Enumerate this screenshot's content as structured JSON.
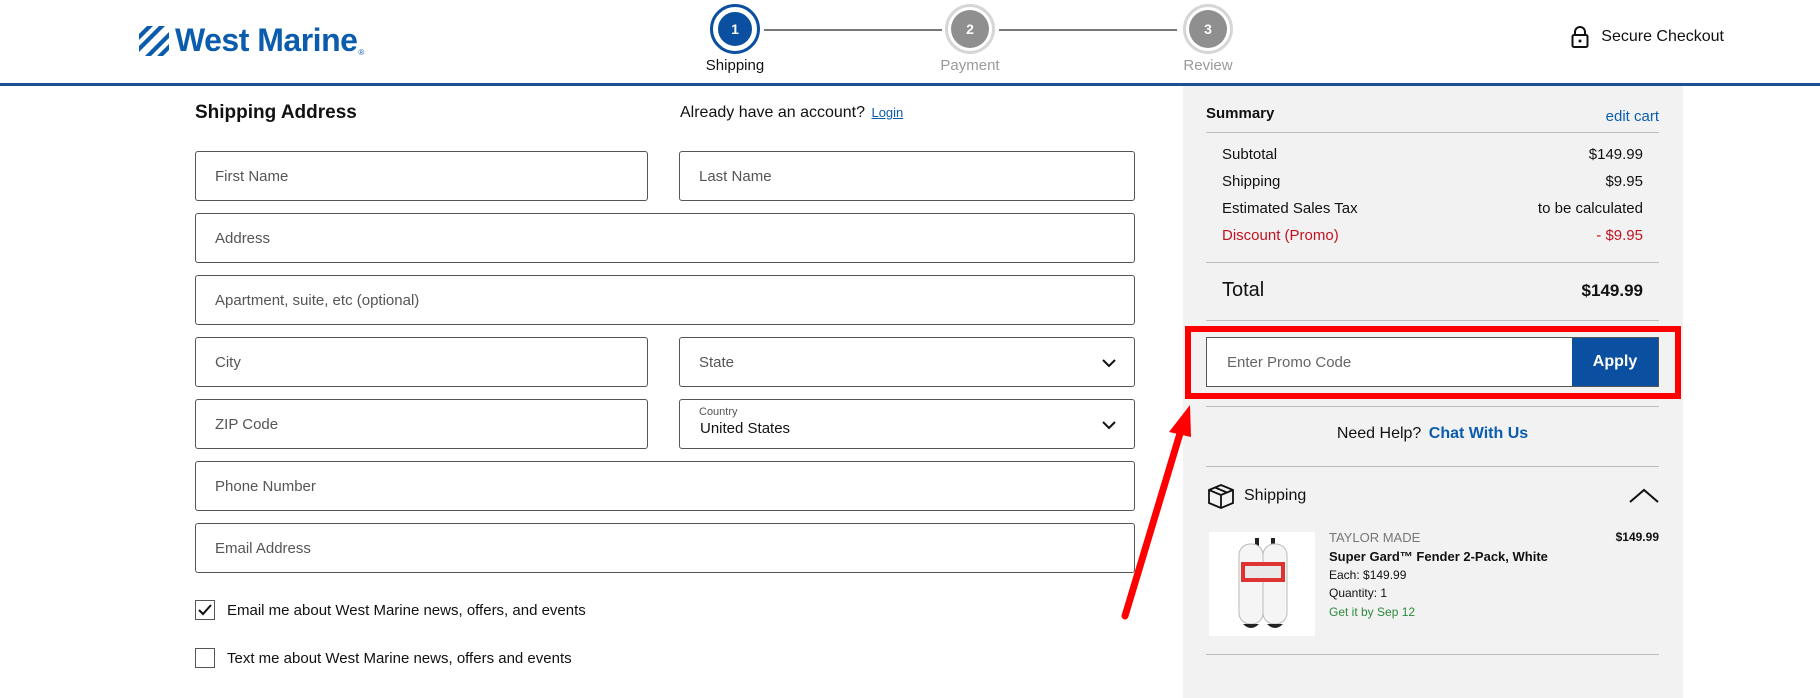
{
  "brand": {
    "name": "West Marine",
    "tm": "®",
    "color": "#0b5cad"
  },
  "steps": [
    {
      "number": "1",
      "label": "Shipping",
      "state": "active"
    },
    {
      "number": "2",
      "label": "Payment",
      "state": "inactive"
    },
    {
      "number": "3",
      "label": "Review",
      "state": "inactive"
    }
  ],
  "header": {
    "secure_label": "Secure Checkout"
  },
  "form": {
    "title": "Shipping Address",
    "account_prompt": "Already have an account?",
    "login_label": "Login",
    "first_name": {
      "placeholder": "First Name",
      "value": ""
    },
    "last_name": {
      "placeholder": "Last Name",
      "value": ""
    },
    "address": {
      "placeholder": "Address",
      "value": ""
    },
    "apartment": {
      "placeholder": "Apartment, suite, etc (optional)",
      "value": ""
    },
    "city": {
      "placeholder": "City",
      "value": ""
    },
    "state": {
      "placeholder": "State"
    },
    "zip": {
      "placeholder": "ZIP Code",
      "value": ""
    },
    "country": {
      "label": "Country",
      "value": "United States"
    },
    "phone": {
      "placeholder": "Phone Number",
      "value": ""
    },
    "email": {
      "placeholder": "Email Address",
      "value": ""
    },
    "email_optin": {
      "label": "Email me about West Marine news, offers, and events",
      "checked": true
    },
    "text_optin": {
      "label": "Text me about West Marine news, offers and events",
      "checked": false
    }
  },
  "summary": {
    "title": "Summary",
    "edit_cart": "edit cart",
    "lines": [
      {
        "label": "Subtotal",
        "value": "$149.99"
      },
      {
        "label": "Shipping",
        "value": "$9.95"
      },
      {
        "label": "Estimated Sales Tax",
        "value": "to be calculated"
      },
      {
        "label": "Discount (Promo)",
        "value": "- $9.95"
      }
    ],
    "total_label": "Total",
    "total_value": "$149.99",
    "promo_placeholder": "Enter Promo Code",
    "apply_label": "Apply",
    "help_prompt": "Need Help?",
    "chat_label": "Chat With Us",
    "shipping_label": "Shipping",
    "item": {
      "brand": "TAYLOR MADE",
      "name": "Super Gard™ Fender 2-Pack, White",
      "each": "Each: $149.99",
      "quantity": "Quantity: 1",
      "delivery": "Get it by Sep 12",
      "price": "$149.99"
    }
  },
  "colors": {
    "accent": "#0b4fa0",
    "discount": "#c1121f",
    "delivery": "#2c8a3c",
    "highlight": "#ff0000"
  }
}
